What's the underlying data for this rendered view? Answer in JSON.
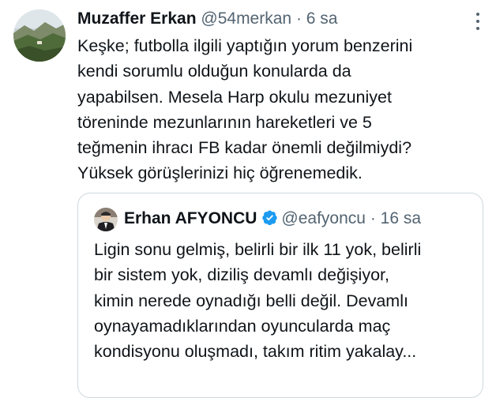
{
  "tweet": {
    "name": "Muzaffer Erkan",
    "handle": "@54merkan",
    "dot": "·",
    "time": "6 sa",
    "more_icon": "more-dots-icon",
    "body_lines": [
      "Keşke; futbolla ilgili yaptığın yorum benzerini",
      "kendi sorumlu olduğun konularda da",
      "yapabilsen. Mesela Harp okulu mezuniyet",
      "töreninde mezunlarının hareketleri ve 5",
      "teğmenin ihracı FB kadar önemli değilmiydi?",
      "Yüksek görüşlerinizi hiç öğrenemedik."
    ]
  },
  "quote": {
    "name": "Erhan AFYONCU",
    "verified_icon": "verified-badge-icon",
    "handle": "@eafyoncu",
    "dot": "·",
    "time": "16 sa",
    "body_lines": [
      "Ligin sonu gelmiş, belirli bir ilk 11 yok, belirli",
      "bir sistem yok, diziliş devamlı değişiyor,",
      "kimin nerede oynadığı belli değil. Devamlı",
      "oynayamadıklarından oyuncularda maç",
      "kondisyonu oluşmadı, takım ritim yakalay..."
    ]
  },
  "colors": {
    "text": "#0f1419",
    "secondary": "#536471",
    "border": "#cfd9de",
    "verified": "#1d9bf0"
  }
}
